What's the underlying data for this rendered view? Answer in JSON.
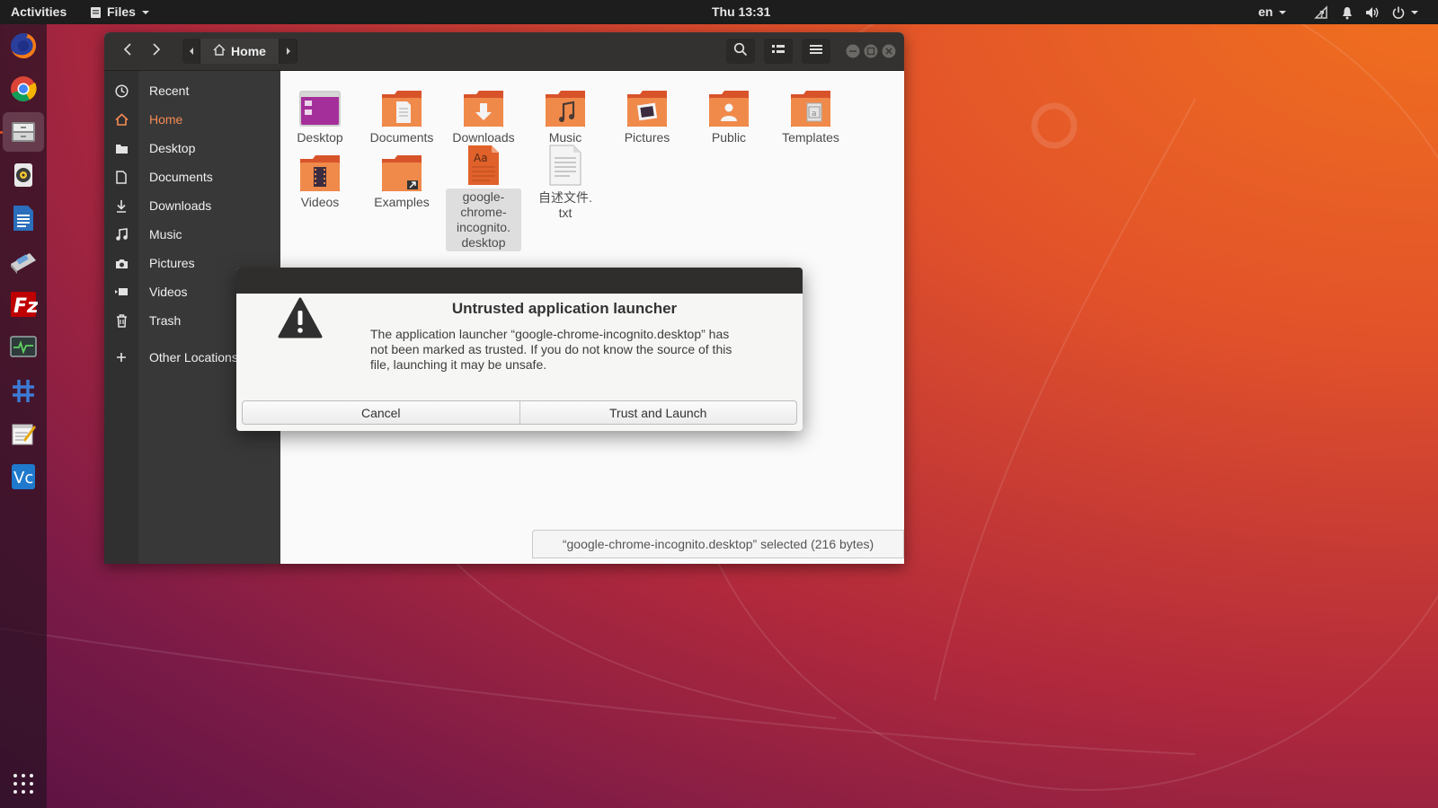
{
  "topbar": {
    "activities": "Activities",
    "app_menu": "Files",
    "clock": "Thu 13:31",
    "keyboard_layout": "en"
  },
  "dock": {
    "items": [
      "firefox-icon",
      "chrome-icon",
      "files-icon",
      "rhythmbox-icon",
      "writer-icon",
      "impress-icon",
      "filezilla-icon",
      "system-monitor-icon",
      "input-method-icon",
      "text-editor-icon",
      "vscode-icon",
      "app-grid-icon"
    ]
  },
  "window": {
    "location": "Home"
  },
  "sidebar": {
    "items": [
      {
        "label": "Recent",
        "icon": "clock-icon"
      },
      {
        "label": "Home",
        "icon": "home-icon"
      },
      {
        "label": "Desktop",
        "icon": "folder-icon"
      },
      {
        "label": "Documents",
        "icon": "document-icon"
      },
      {
        "label": "Downloads",
        "icon": "download-icon"
      },
      {
        "label": "Music",
        "icon": "music-icon"
      },
      {
        "label": "Pictures",
        "icon": "camera-icon"
      },
      {
        "label": "Videos",
        "icon": "video-icon"
      },
      {
        "label": "Trash",
        "icon": "trash-icon"
      },
      {
        "label": "Other Locations",
        "icon": "plus-icon"
      }
    ],
    "selected": "Home"
  },
  "files": [
    {
      "name": "Desktop",
      "type": "desktop-folder"
    },
    {
      "name": "Documents",
      "type": "documents-folder"
    },
    {
      "name": "Downloads",
      "type": "downloads-folder"
    },
    {
      "name": "Music",
      "type": "music-folder"
    },
    {
      "name": "Pictures",
      "type": "pictures-folder"
    },
    {
      "name": "Public",
      "type": "public-folder"
    },
    {
      "name": "Templates",
      "type": "templates-folder"
    },
    {
      "name": "Videos",
      "type": "videos-folder"
    },
    {
      "name": "Examples",
      "type": "link-folder"
    },
    {
      "name": "google-chrome-incognito.desktop",
      "type": "font-file",
      "display": [
        "google-",
        "chrome-",
        "incognito.",
        "desktop"
      ]
    },
    {
      "name": "自述文件.txt",
      "type": "text-file",
      "display": [
        "自述文件.",
        "txt"
      ]
    }
  ],
  "status": "“google-chrome-incognito.desktop” selected  (216 bytes)",
  "dialog": {
    "title": "Untrusted application launcher",
    "body_lines": [
      "The application launcher “google-chrome-incognito.desktop” has",
      "not been marked as trusted. If you do not know the source of this",
      "file, launching it may be unsafe."
    ],
    "cancel_label": "Cancel",
    "trust_label": "Trust and Launch"
  },
  "colors": {
    "accent": "#e95420",
    "topbar": "#1d1d1d",
    "headerbar": "#333231",
    "sidebar": "#383838"
  }
}
